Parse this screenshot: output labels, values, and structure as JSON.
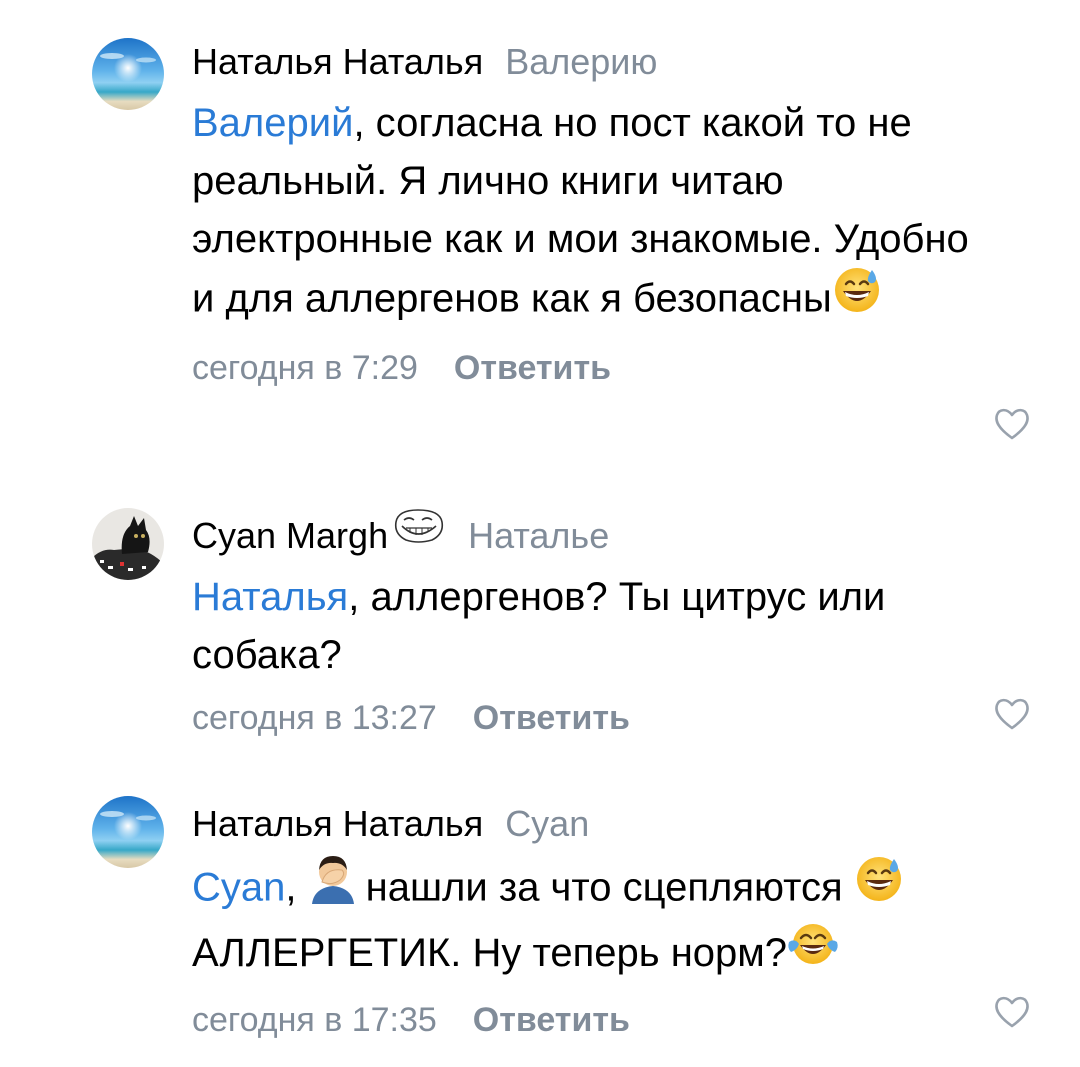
{
  "comments": [
    {
      "author": "Наталья Наталья",
      "reply_to": "Валерию",
      "mention": "Валерий",
      "text_1": ", согласна но пост какой то не реальный. Я лично книги читаю электронные как и мои знакомые. Удобно и для аллергенов как я безопасны",
      "emoji_end": "grinning-sweat-emoji",
      "time": "сегодня в 7:29",
      "reply_label": "Ответить",
      "avatar": "beach-avatar"
    },
    {
      "author": "Cyan Margh",
      "author_emoji": "trollface-emoji",
      "reply_to": "Наталье",
      "mention": "Наталья",
      "text_1": ", аллергенов? Ты цитрус или собака?",
      "time": "сегодня в 13:27",
      "reply_label": "Ответить",
      "avatar": "black-cat-avatar"
    },
    {
      "author": "Наталья Наталья",
      "reply_to": "Cyan",
      "mention": "Cyan",
      "text_1": ", ",
      "emoji_1": "facepalm-emoji",
      "text_2": "нашли за что сцепляются ",
      "emoji_2": "grinning-sweat-emoji",
      "text_3": " АЛЛЕРГЕТИК. Ну теперь норм?",
      "emoji_3": "tears-of-joy-emoji",
      "time": "сегодня в 17:35",
      "reply_label": "Ответить",
      "avatar": "beach-avatar"
    }
  ],
  "colors": {
    "mention": "#2a7bd6",
    "meta": "#818c99",
    "text": "#000000",
    "background": "#ffffff"
  },
  "icons": {
    "like": "heart-outline-icon"
  }
}
